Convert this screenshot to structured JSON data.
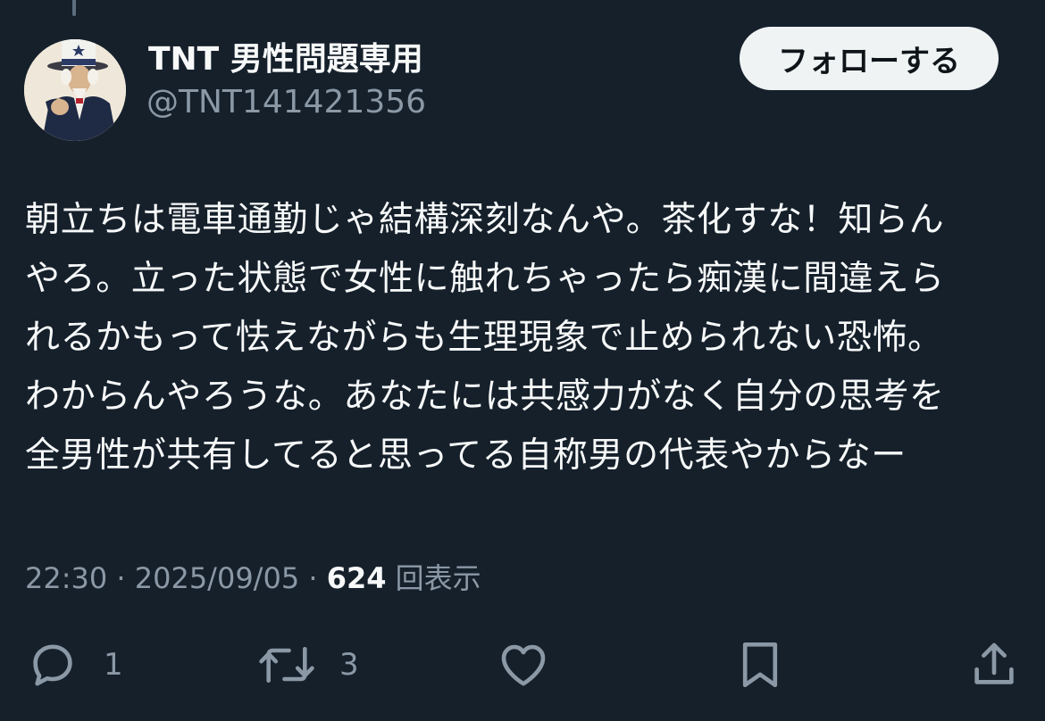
{
  "author": {
    "name": "TNT 男性問題専用",
    "handle": "@TNT141421356"
  },
  "follow_button": {
    "label": "フォローする"
  },
  "tweet": {
    "lines": [
      "朝立ちは電車通勤じゃ結構深刻なんや。茶化すな！知らん",
      "やろ。立った状態で女性に触れちゃったら痴漢に間違えら",
      "れるかもって怯えながらも生理現象で止められない恐怖。",
      "わからんやろうな。あなたには共感力がなく自分の思考を",
      "全男性が共有してると思ってる自称男の代表やからなー"
    ]
  },
  "meta": {
    "time": "22:30",
    "separator": " · ",
    "date": "2025/09/05",
    "views_count": "624",
    "views_label": "回表示"
  },
  "actions": {
    "reply": {
      "icon": "reply-icon",
      "count": "1"
    },
    "retweet": {
      "icon": "retweet-icon",
      "count": "3"
    },
    "like": {
      "icon": "heart-icon"
    },
    "bookmark": {
      "icon": "bookmark-icon"
    },
    "share": {
      "icon": "share-icon"
    }
  },
  "colors": {
    "background": "#15202b",
    "text_primary": "#f7f9f9",
    "text_secondary": "#8b98a5",
    "button_bg": "#eff3f4",
    "button_text": "#0f1419"
  }
}
